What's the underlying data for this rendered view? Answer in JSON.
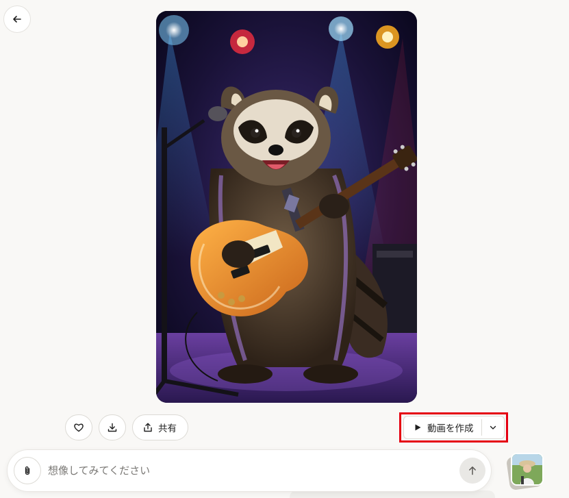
{
  "nav": {
    "back_icon": "arrow-left-icon"
  },
  "image": {
    "subject": "raccoon-playing-electric-guitar-on-stage"
  },
  "actions": {
    "like_icon": "heart-icon",
    "download_icon": "download-icon",
    "share_icon": "share-icon",
    "share_label": "共有"
  },
  "video": {
    "play_icon": "play-icon",
    "label": "動画を作成",
    "dropdown_icon": "chevron-down-icon",
    "highlight_color": "#e50012"
  },
  "composer": {
    "attach_icon": "paperclip-icon",
    "placeholder": "想像してみてください",
    "value": "",
    "send_icon": "arrow-up-icon"
  },
  "colors": {
    "background": "#f9f8f6",
    "button_border": "#dcdad5",
    "send_bg": "#e9e8e5"
  }
}
